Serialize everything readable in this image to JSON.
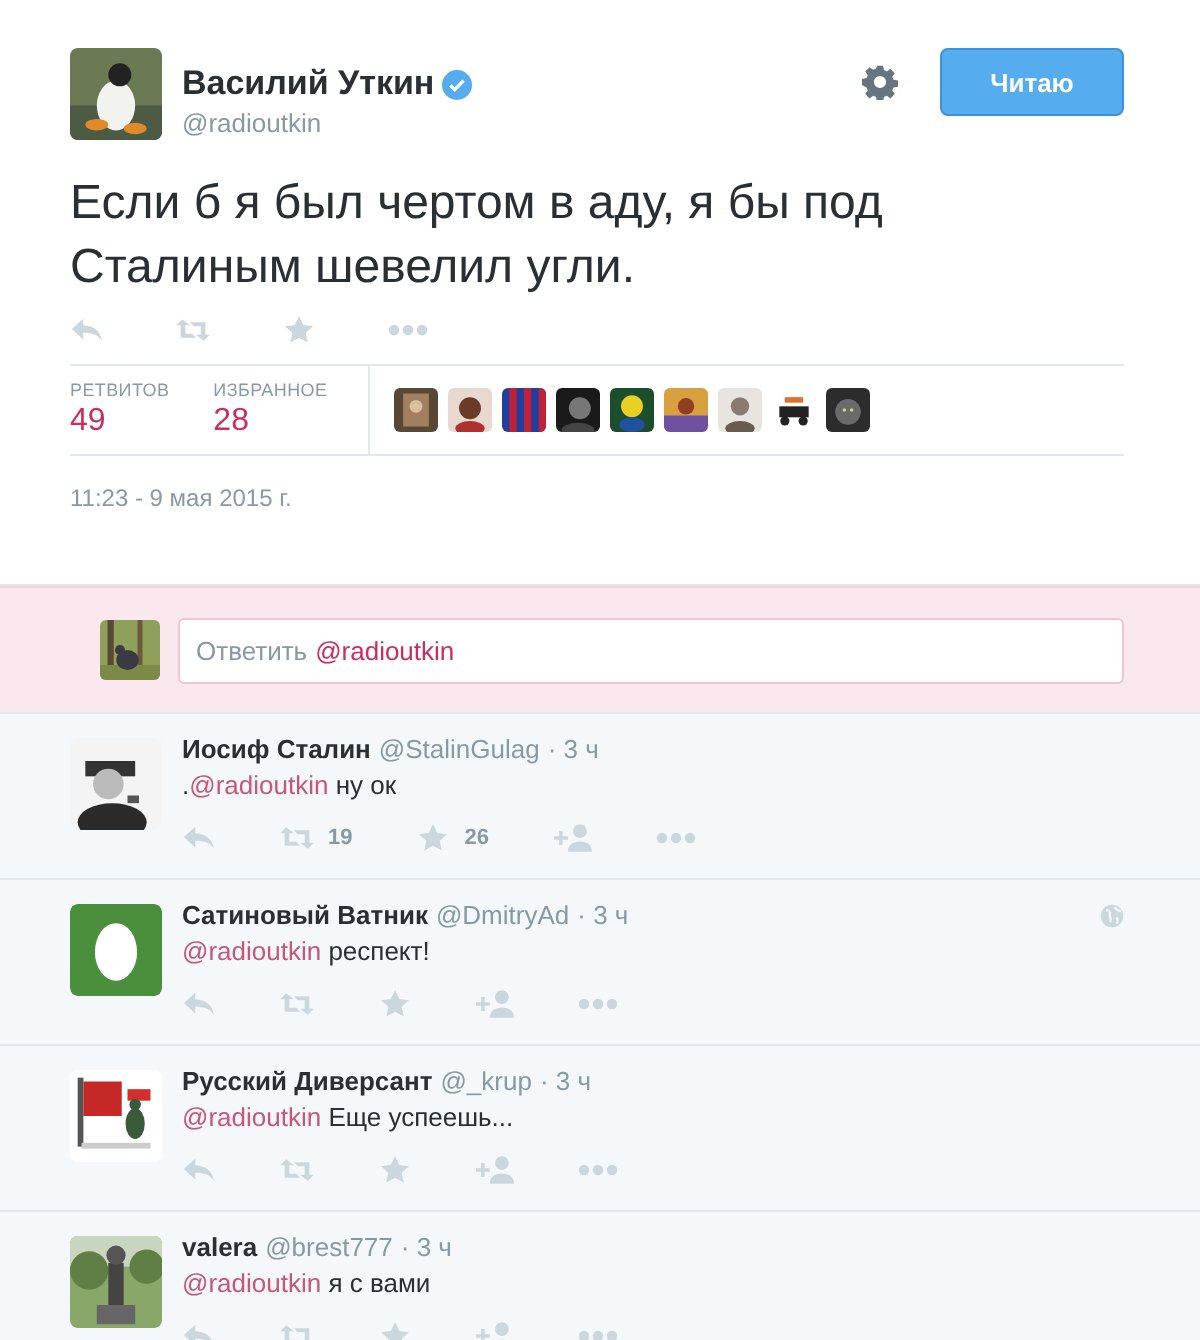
{
  "author": {
    "name": "Василий Уткин",
    "verified": true,
    "handle": "@radioutkin",
    "avatar": {
      "kind": "picture"
    }
  },
  "follow_button": "Читаю",
  "tweet_text": "Если б я был чертом в аду, я бы под Сталиным шевелил угли.",
  "stats": [
    {
      "label": "РЕТВИТОВ",
      "value": "49"
    },
    {
      "label": "ИЗБРАННОЕ",
      "value": "28"
    }
  ],
  "favoriters": [
    {
      "kind": "picture"
    },
    {
      "kind": "picture"
    },
    {
      "kind": "picture"
    },
    {
      "kind": "picture"
    },
    {
      "kind": "picture"
    },
    {
      "kind": "picture"
    },
    {
      "kind": "picture"
    },
    {
      "kind": "picture"
    },
    {
      "kind": "picture"
    }
  ],
  "timestamp": "11:23 - 9 мая 2015 г.",
  "reply_box": {
    "avatar": {
      "kind": "picture"
    },
    "placeholder": "Ответить",
    "mention": "@radioutkin"
  },
  "replies": [
    {
      "avatar": {
        "kind": "picture"
      },
      "name": "Иосиф Сталин",
      "handle": "@StalinGulag",
      "time": "· 3 ч",
      "geo": false,
      "text": [
        {
          "kind": "plain",
          "text": "."
        },
        {
          "kind": "mention",
          "text": "@radioutkin"
        },
        {
          "kind": "plain",
          "text": " ну ок"
        }
      ],
      "retweet_count": "19",
      "favorite_count": "26"
    },
    {
      "avatar": {
        "kind": "egg"
      },
      "name": "Сатиновый Ватник",
      "handle": "@DmitryAd",
      "time": "· 3 ч",
      "geo": true,
      "text": [
        {
          "kind": "mention",
          "text": "@radioutkin"
        },
        {
          "kind": "plain",
          "text": " респект!"
        }
      ]
    },
    {
      "avatar": {
        "kind": "picture"
      },
      "name": "Русский Диверсант",
      "handle": "@_krup",
      "time": "· 3 ч",
      "geo": false,
      "text": [
        {
          "kind": "mention",
          "text": "@radioutkin"
        },
        {
          "kind": "plain",
          "text": " Еще успеешь..."
        }
      ]
    },
    {
      "avatar": {
        "kind": "picture"
      },
      "name": "valera",
      "handle": "@brest777",
      "time": "· 3 ч",
      "geo": false,
      "text": [
        {
          "kind": "mention",
          "text": "@radioutkin"
        },
        {
          "kind": "plain",
          "text": " я с вами"
        }
      ]
    }
  ]
}
